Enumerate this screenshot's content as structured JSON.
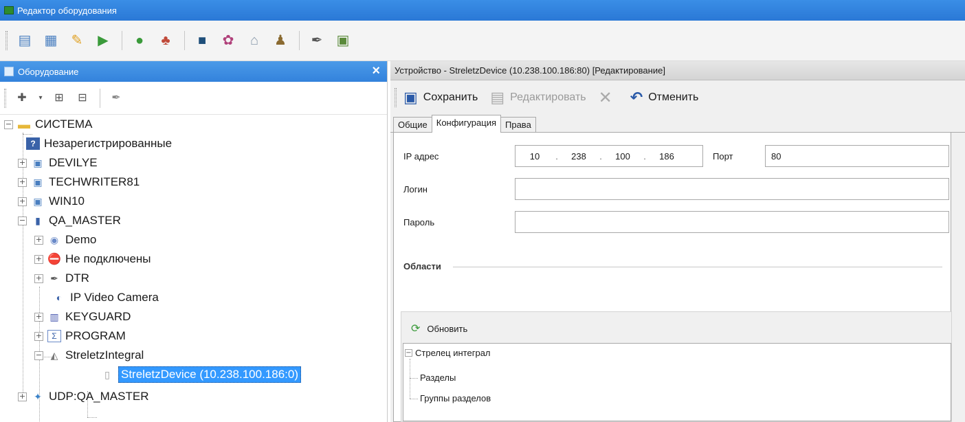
{
  "window": {
    "title": "Редактор оборудования"
  },
  "left_panel": {
    "title": "Оборудование",
    "tree": [
      {
        "label": "СИСТЕМА",
        "icon": "folder-icon",
        "expander": "−"
      },
      {
        "label": "Незарегистрированные",
        "icon": "unregistered-icon",
        "expander": ""
      },
      {
        "label": "DEVILYE",
        "icon": "computer-icon",
        "expander": "+"
      },
      {
        "label": "TECHWRITER81",
        "icon": "computer-icon",
        "expander": "+"
      },
      {
        "label": "WIN10",
        "icon": "computer-icon",
        "expander": "+"
      },
      {
        "label": "QA_MASTER",
        "icon": "server-icon",
        "expander": "−"
      },
      {
        "label": "Demo",
        "icon": "globe-icon",
        "expander": "+"
      },
      {
        "label": "Не подключены",
        "icon": "no-entry-icon",
        "expander": "+"
      },
      {
        "label": "DTR",
        "icon": "pen-icon",
        "expander": "+"
      },
      {
        "label": "IP Video Camera",
        "icon": "camera-icon",
        "expander": ""
      },
      {
        "label": "KEYGUARD",
        "icon": "keyguard-icon",
        "expander": "+"
      },
      {
        "label": "PROGRAM",
        "icon": "function-icon",
        "expander": "+"
      },
      {
        "label": "StreletzIntegral",
        "icon": "integral-icon",
        "expander": "−"
      },
      {
        "label": "StreletzDevice (10.238.100.186:0)",
        "icon": "device-icon",
        "expander": ""
      },
      {
        "label": "UDP:QA_MASTER",
        "icon": "udp-icon",
        "expander": "+"
      }
    ]
  },
  "right_panel": {
    "header": "Устройство - StreletzDevice (10.238.100.186:80) [Редактирование]",
    "toolbar": {
      "save": "Сохранить",
      "edit": "Редактировать",
      "cancel": "Отменить"
    },
    "tabs": [
      "Общие",
      "Конфигурация",
      "Права"
    ],
    "active_tab": "Конфигурация",
    "form": {
      "ip_label": "IP адрес",
      "ip": [
        "10",
        "238",
        "100",
        "186"
      ],
      "port_label": "Порт",
      "port": "80",
      "login_label": "Логин",
      "login": "",
      "password_label": "Пароль",
      "password": ""
    },
    "areas": {
      "group_label": "Области",
      "refresh": "Обновить",
      "tree": {
        "root": "Стрелец интеграл",
        "children": [
          "Разделы",
          "Группы разделов"
        ]
      }
    }
  }
}
